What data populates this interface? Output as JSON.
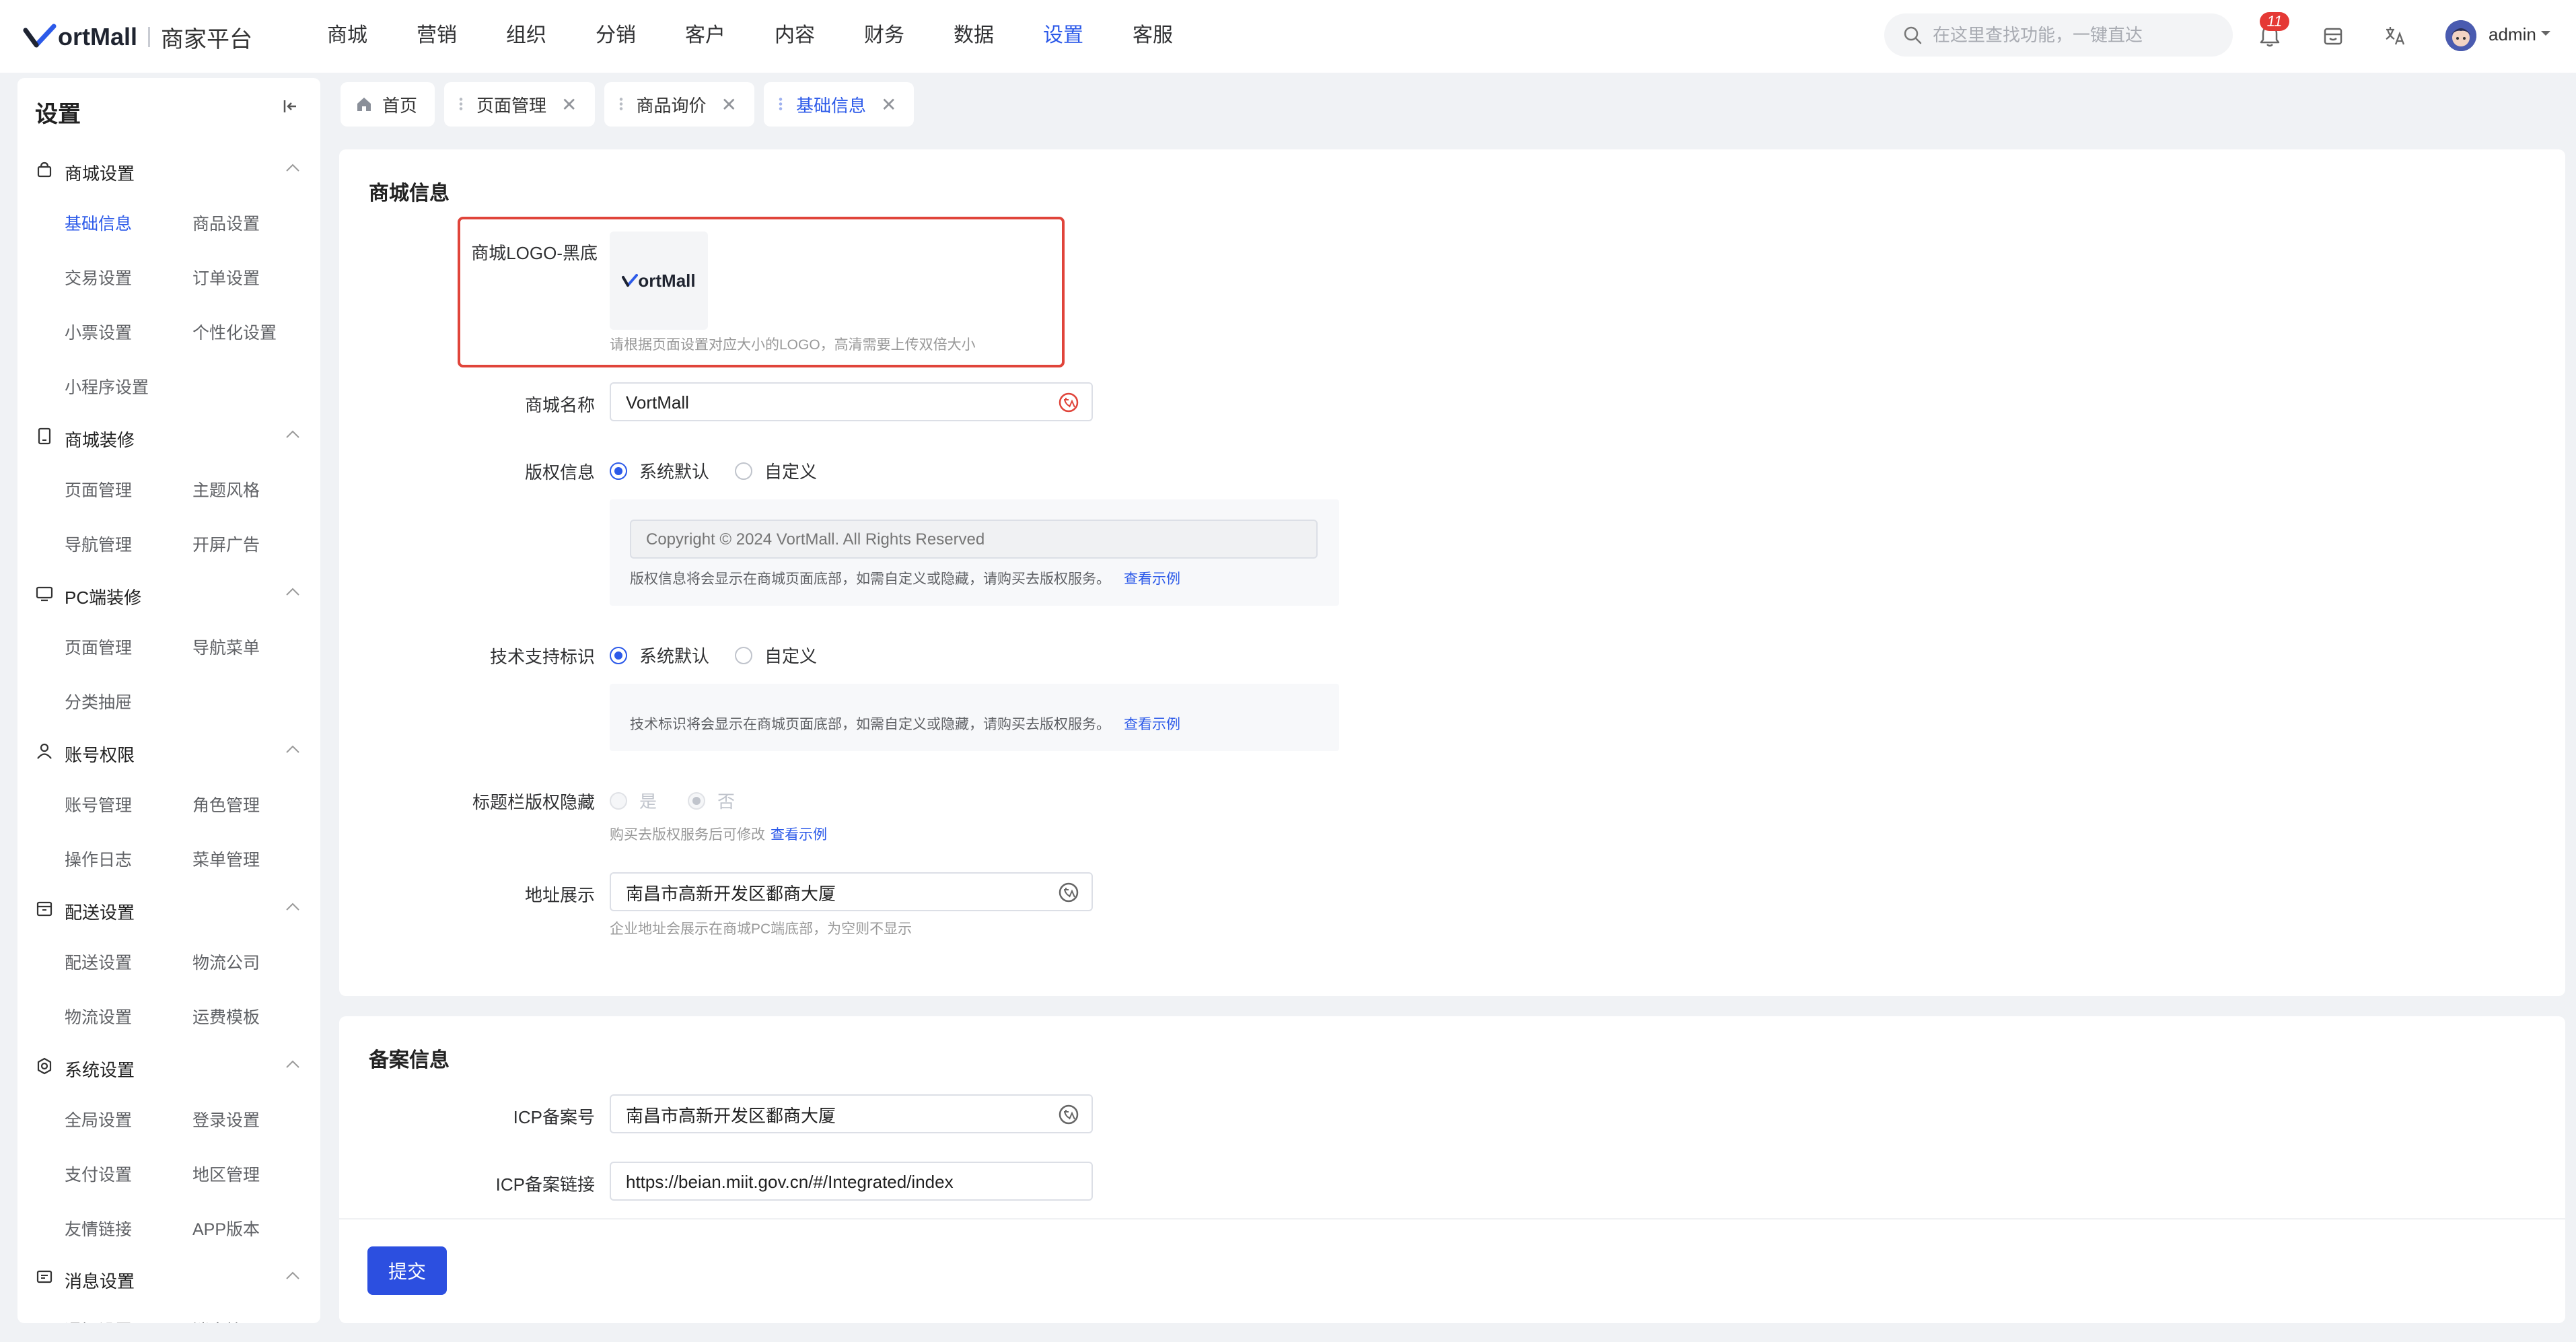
{
  "brand": {
    "logo_text": "ortMall",
    "platform": "商家平台"
  },
  "top_nav": [
    {
      "label": "商城",
      "active": false
    },
    {
      "label": "营销",
      "active": false
    },
    {
      "label": "组织",
      "active": false
    },
    {
      "label": "分销",
      "active": false
    },
    {
      "label": "客户",
      "active": false
    },
    {
      "label": "内容",
      "active": false
    },
    {
      "label": "财务",
      "active": false
    },
    {
      "label": "数据",
      "active": false
    },
    {
      "label": "设置",
      "active": true
    },
    {
      "label": "客服",
      "active": false
    }
  ],
  "search": {
    "placeholder": "在这里查找功能，一键直达"
  },
  "header": {
    "notification_count": "11",
    "user_name": "admin"
  },
  "sidebar": {
    "title": "设置",
    "groups": [
      {
        "label": "商城设置",
        "icon": "shop-bag-icon",
        "items": [
          "基础信息",
          "商品设置",
          "交易设置",
          "订单设置",
          "小票设置",
          "个性化设置",
          "小程序设置"
        ]
      },
      {
        "label": "商城装修",
        "icon": "tablet-icon",
        "items": [
          "页面管理",
          "主题风格",
          "导航管理",
          "开屏广告"
        ]
      },
      {
        "label": "PC端装修",
        "icon": "monitor-icon",
        "items": [
          "页面管理",
          "导航菜单",
          "分类抽屉"
        ]
      },
      {
        "label": "账号权限",
        "icon": "user-icon",
        "items": [
          "账号管理",
          "角色管理",
          "操作日志",
          "菜单管理"
        ]
      },
      {
        "label": "配送设置",
        "icon": "box-icon",
        "items": [
          "配送设置",
          "物流公司",
          "物流设置",
          "运费模板"
        ]
      },
      {
        "label": "系统设置",
        "icon": "settings-icon",
        "items": [
          "全局设置",
          "登录设置",
          "支付设置",
          "地区管理",
          "友情链接",
          "APP版本"
        ]
      },
      {
        "label": "消息设置",
        "icon": "message-icon",
        "items": [
          "通知设置",
          "消息管理"
        ]
      }
    ],
    "active_item": "基础信息"
  },
  "tabs": [
    {
      "label": "首页",
      "icon": "home-icon",
      "closable": false,
      "active": false
    },
    {
      "label": "页面管理",
      "closable": true,
      "active": false
    },
    {
      "label": "商品询价",
      "closable": true,
      "active": false
    },
    {
      "label": "基础信息",
      "closable": true,
      "active": true
    }
  ],
  "mall_info": {
    "title": "商城信息",
    "logo_label": "商城LOGO-黑底",
    "logo_text": "ortMall",
    "logo_hint": "请根据页面设置对应大小的LOGO，高清需要上传双倍大小",
    "name_label": "商城名称",
    "name_value": "VortMall",
    "copyright_label": "版权信息",
    "copyright_options": [
      "系统默认",
      "自定义"
    ],
    "copyright_selected": "系统默认",
    "copyright_placeholder": "Copyright © 2024 VortMall. All Rights Reserved",
    "copyright_hint": "版权信息将会显示在商城页面底部，如需自定义或隐藏，请购买去版权服务。",
    "copyright_link": "查看示例",
    "tech_label": "技术支持标识",
    "tech_options": [
      "系统默认",
      "自定义"
    ],
    "tech_selected": "系统默认",
    "tech_hint": "技术标识将会显示在商城页面底部，如需自定义或隐藏，请购买去版权服务。",
    "tech_link": "查看示例",
    "hide_label": "标题栏版权隐藏",
    "hide_options": [
      "是",
      "否"
    ],
    "hide_selected": "否",
    "hide_hint": "购买去版权服务后可修改",
    "hide_link": "查看示例",
    "address_label": "地址展示",
    "address_value": "南昌市高新开发区鄱商大厦",
    "address_hint": "企业地址会展示在商城PC端底部，为空则不显示"
  },
  "filing_info": {
    "title": "备案信息",
    "icp_label": "ICP备案号",
    "icp_value": "南昌市高新开发区鄱商大厦",
    "icp_link_label": "ICP备案链接",
    "icp_link_value": "https://beian.miit.gov.cn/#/Integrated/index"
  },
  "actions": {
    "submit": "提交"
  },
  "colors": {
    "accent": "#2c5ae9",
    "highlight_border": "#e0443a",
    "badge": "#e53935"
  }
}
